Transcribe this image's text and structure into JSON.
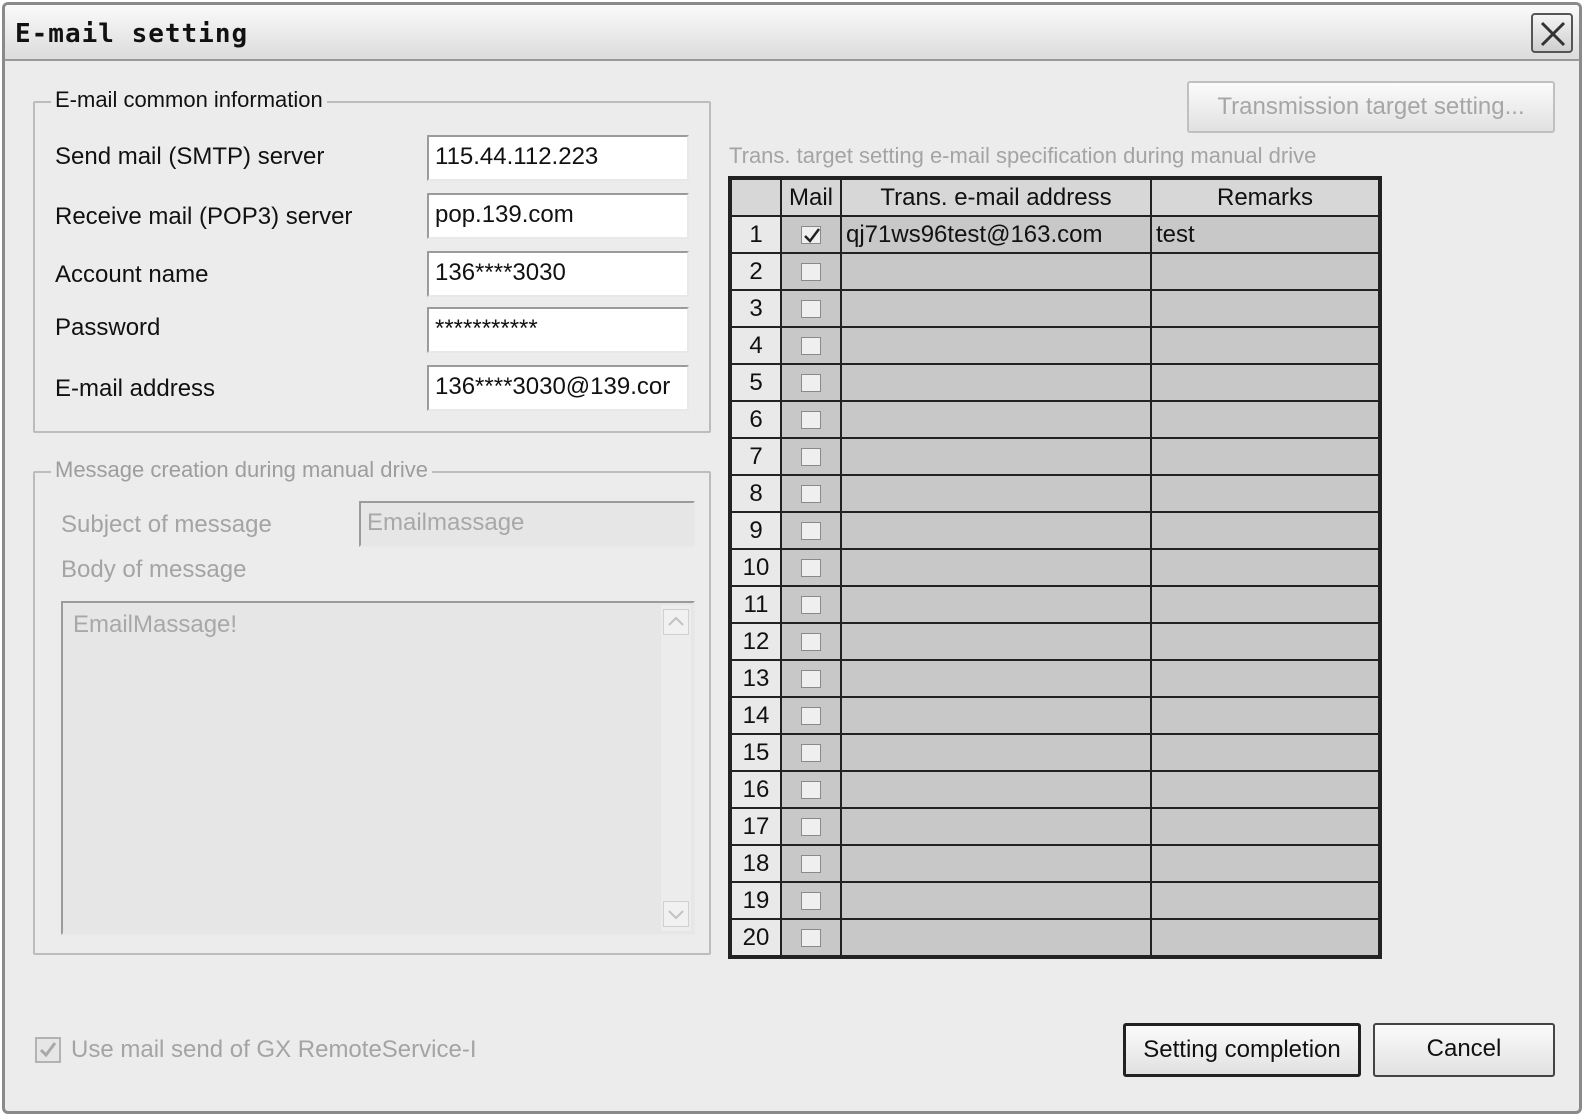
{
  "window": {
    "title": "E-mail setting"
  },
  "common": {
    "legend": "E-mail common information",
    "smtp_label": "Send mail (SMTP) server",
    "smtp_value": "115.44.112.223",
    "pop3_label": "Receive mail (POP3) server",
    "pop3_value": "pop.139.com",
    "account_label": "Account name",
    "account_value": "136****3030",
    "password_label": "Password",
    "password_value": "***********",
    "email_label": "E-mail address",
    "email_value": "136****3030@139.cor"
  },
  "message": {
    "legend": "Message creation during manual drive",
    "subject_label": "Subject of message",
    "subject_value": "Emailmassage",
    "body_label": "Body of message",
    "body_value": "EmailMassage!"
  },
  "targets": {
    "button_label": "Transmission target setting...",
    "caption": "Trans. target setting e-mail specification during manual drive",
    "headers": {
      "num": "",
      "mail": "Mail",
      "address": "Trans. e-mail address",
      "remarks": "Remarks"
    },
    "rows": [
      {
        "num": "1",
        "checked": true,
        "address": "qj71ws96test@163.com",
        "remarks": "test"
      },
      {
        "num": "2",
        "checked": false,
        "address": "",
        "remarks": ""
      },
      {
        "num": "3",
        "checked": false,
        "address": "",
        "remarks": ""
      },
      {
        "num": "4",
        "checked": false,
        "address": "",
        "remarks": ""
      },
      {
        "num": "5",
        "checked": false,
        "address": "",
        "remarks": ""
      },
      {
        "num": "6",
        "checked": false,
        "address": "",
        "remarks": ""
      },
      {
        "num": "7",
        "checked": false,
        "address": "",
        "remarks": ""
      },
      {
        "num": "8",
        "checked": false,
        "address": "",
        "remarks": ""
      },
      {
        "num": "9",
        "checked": false,
        "address": "",
        "remarks": ""
      },
      {
        "num": "10",
        "checked": false,
        "address": "",
        "remarks": ""
      },
      {
        "num": "11",
        "checked": false,
        "address": "",
        "remarks": ""
      },
      {
        "num": "12",
        "checked": false,
        "address": "",
        "remarks": ""
      },
      {
        "num": "13",
        "checked": false,
        "address": "",
        "remarks": ""
      },
      {
        "num": "14",
        "checked": false,
        "address": "",
        "remarks": ""
      },
      {
        "num": "15",
        "checked": false,
        "address": "",
        "remarks": ""
      },
      {
        "num": "16",
        "checked": false,
        "address": "",
        "remarks": ""
      },
      {
        "num": "17",
        "checked": false,
        "address": "",
        "remarks": ""
      },
      {
        "num": "18",
        "checked": false,
        "address": "",
        "remarks": ""
      },
      {
        "num": "19",
        "checked": false,
        "address": "",
        "remarks": ""
      },
      {
        "num": "20",
        "checked": false,
        "address": "",
        "remarks": ""
      }
    ]
  },
  "footer": {
    "use_gx_label": "Use mail send of GX RemoteService-I",
    "use_gx_checked": true,
    "complete_label": "Setting completion",
    "cancel_label": "Cancel"
  }
}
